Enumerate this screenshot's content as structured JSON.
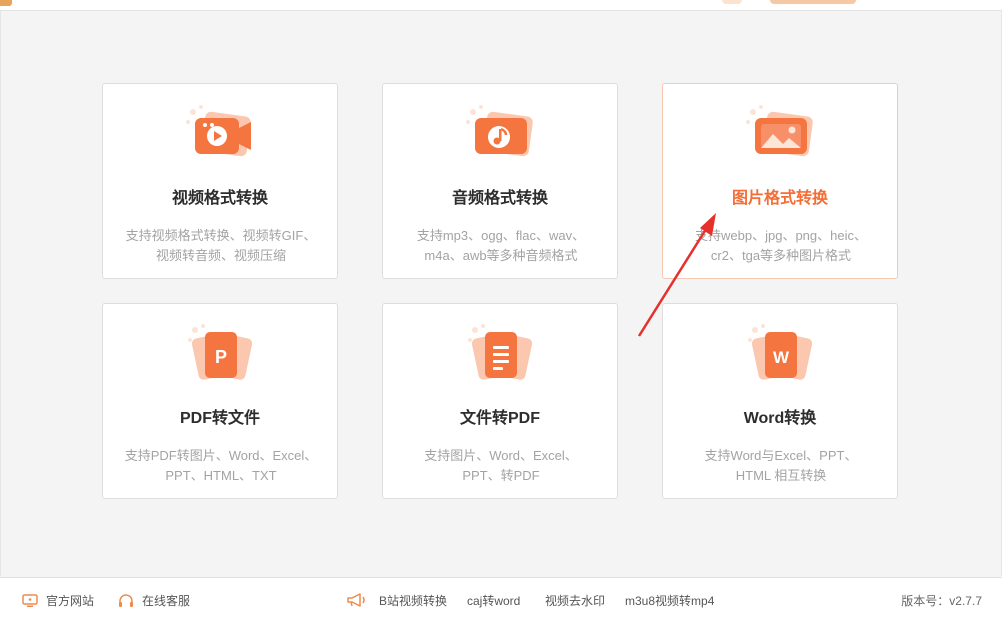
{
  "cards": [
    {
      "title": "视频格式转换",
      "desc": [
        "支持视频格式转换、视频转GIF、",
        "视频转音频、视频压缩"
      ],
      "icon": "video-icon"
    },
    {
      "title": "音频格式转换",
      "desc": [
        "支持mp3、ogg、flac、wav、",
        "m4a、awb等多种音频格式"
      ],
      "icon": "music-icon"
    },
    {
      "title": "图片格式转换",
      "desc": [
        "支持webp、jpg、png、heic、",
        "cr2、tga等多种图片格式"
      ],
      "icon": "image-icon"
    },
    {
      "title": "PDF转文件",
      "desc": [
        "支持PDF转图片、Word、Excel、",
        "PPT、HTML、TXT"
      ],
      "icon": "pdf-icon",
      "letter": "P"
    },
    {
      "title": "文件转PDF",
      "desc": [
        "支持图片、Word、Excel、",
        "PPT、转PDF"
      ],
      "icon": "document-icon"
    },
    {
      "title": "Word转换",
      "desc": [
        "支持Word与Excel、PPT、",
        "HTML 相互转换"
      ],
      "icon": "word-icon",
      "letter": "W"
    }
  ],
  "footer": {
    "website": "官方网站",
    "service": "在线客服",
    "links": [
      "B站视频转换",
      "caj转word",
      "视频去水印",
      "m3u8视频转mp4"
    ],
    "version": "版本号：v2.7.7"
  },
  "colors": {
    "accent": "#f56d35",
    "arrow": "#e5302b"
  }
}
